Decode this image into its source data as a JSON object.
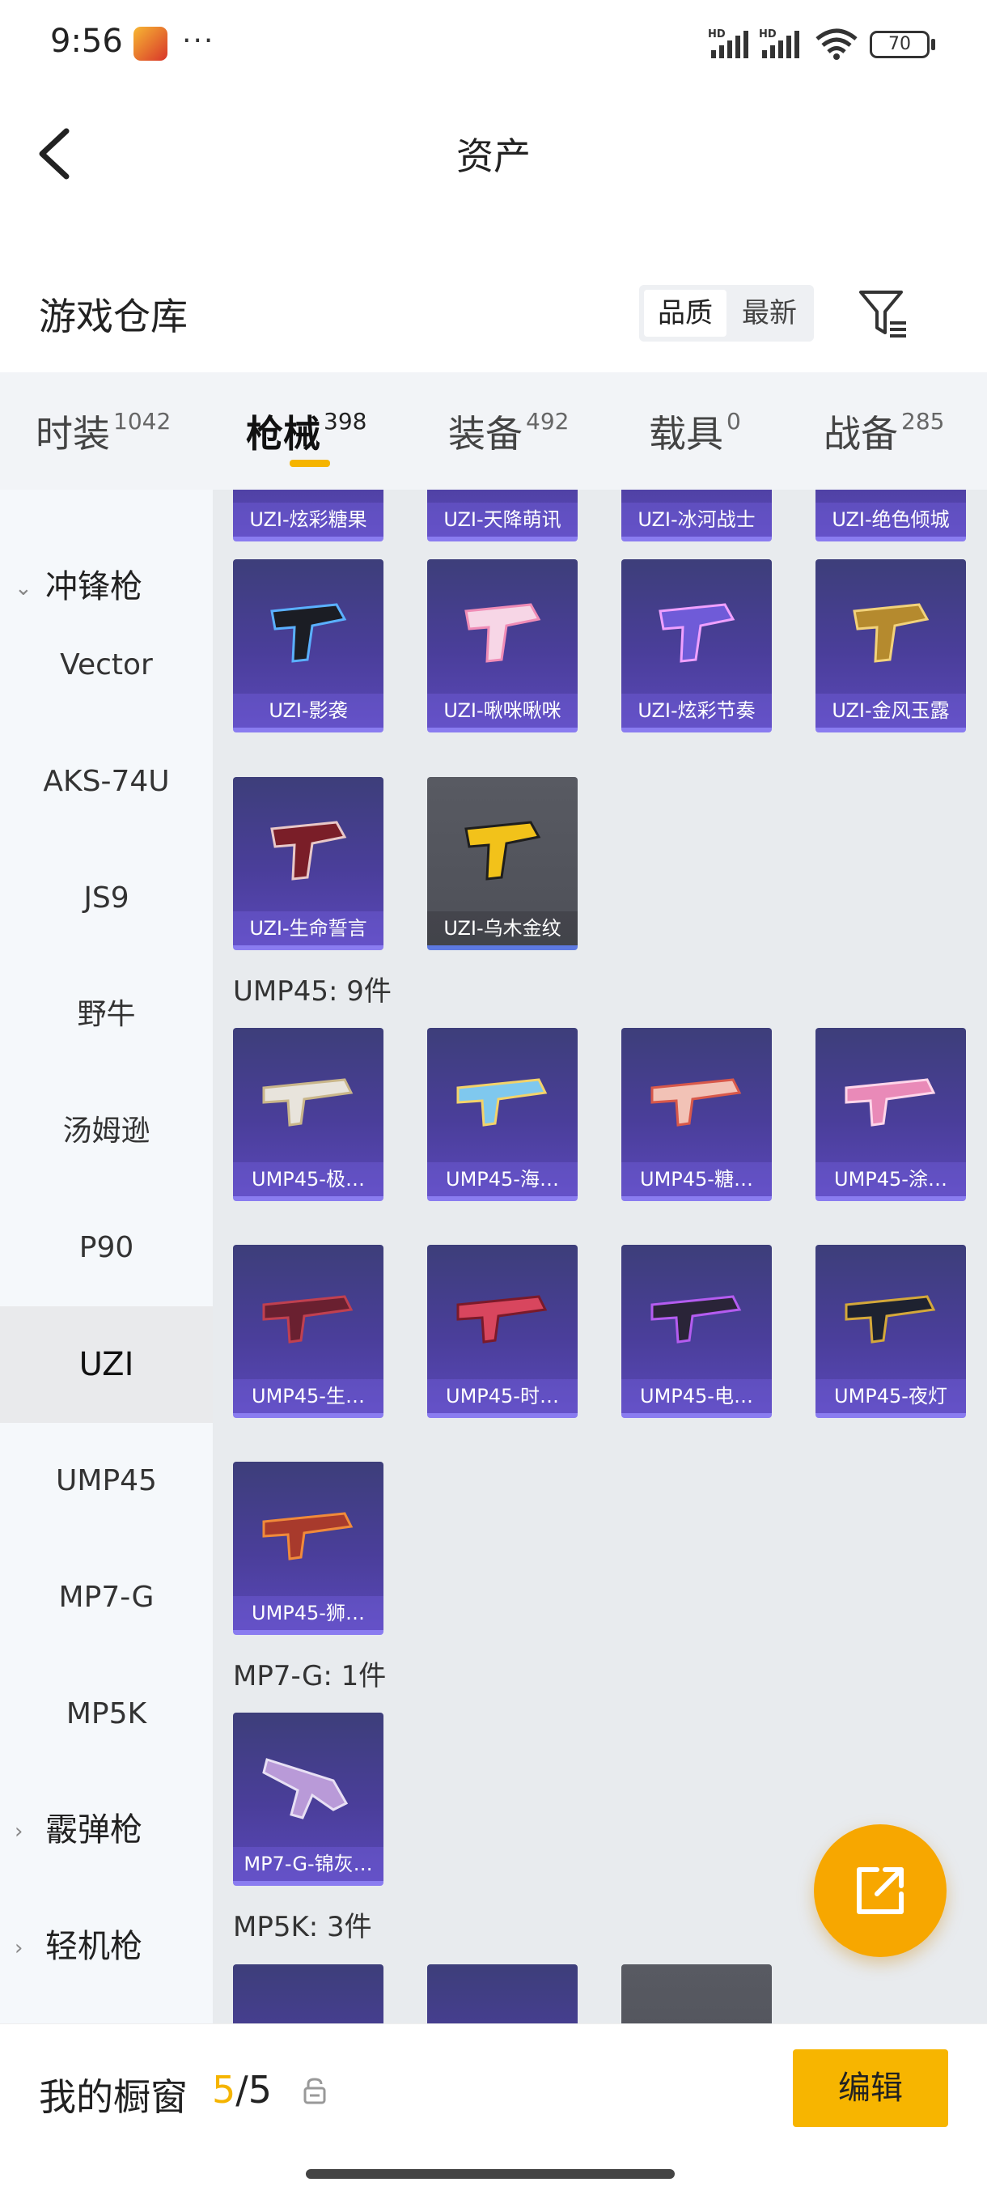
{
  "status": {
    "time": "9:56",
    "more": "···",
    "battery": "70",
    "net1": "HD",
    "net2": "HD"
  },
  "header": {
    "title": "资产"
  },
  "warehouse": {
    "title": "游戏仓库",
    "sort_quality": "品质",
    "sort_newest": "最新"
  },
  "tabs": [
    {
      "label": "时装",
      "count": "1042"
    },
    {
      "label": "枪械",
      "count": "398"
    },
    {
      "label": "装备",
      "count": "492"
    },
    {
      "label": "载具",
      "count": "0"
    },
    {
      "label": "战备",
      "count": "285"
    }
  ],
  "sidebar": {
    "group1": "冲锋枪",
    "items": [
      "Vector",
      "AKS-74U",
      "JS9",
      "野牛",
      "汤姆逊",
      "P90",
      "UZI",
      "UMP45",
      "MP7-G",
      "MP5K"
    ],
    "group2": "霰弹枪",
    "group3": "轻机枪"
  },
  "content": {
    "top_partial": [
      "UZI-炫彩糖果",
      "UZI-天降萌讯",
      "UZI-冰河战士",
      "UZI-绝色倾城"
    ],
    "uzi_row1": [
      "UZI-影袭",
      "UZI-啾咪啾咪",
      "UZI-炫彩节奏",
      "UZI-金风玉露"
    ],
    "uzi_row2": [
      "UZI-生命誓言",
      "UZI-乌木金纹"
    ],
    "ump_title": "UMP45: 9件",
    "ump_row1": [
      "UMP45-极…",
      "UMP45-海…",
      "UMP45-糖…",
      "UMP45-涂…"
    ],
    "ump_row2": [
      "UMP45-生…",
      "UMP45-时…",
      "UMP45-电…",
      "UMP45-夜灯"
    ],
    "ump_row3": [
      "UMP45-狮…"
    ],
    "mp7_title": "MP7-G: 1件",
    "mp7_row1": [
      "MP7-G-锦灰…"
    ],
    "mp5k_title": "MP5K: 3件"
  },
  "bottom": {
    "title": "我的橱窗",
    "count_current": "5",
    "count_sep": "/",
    "count_total": "5",
    "edit_label": "编辑"
  },
  "colors": {
    "accent": "#f5b400",
    "card_purple": "#4a3e9a",
    "fab": "#f7a700"
  }
}
